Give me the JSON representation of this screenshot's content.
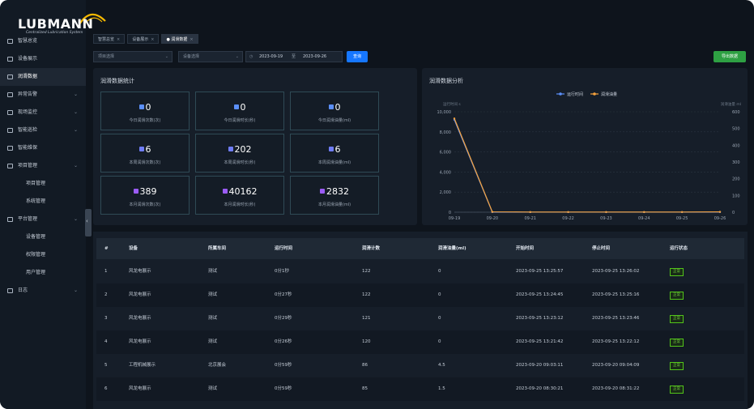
{
  "brand": {
    "name": "LUBMANN",
    "subtitle": "Centralized Lubrication System"
  },
  "sidebar": {
    "items": [
      {
        "label": "智慧总览",
        "icon": "grid-icon",
        "expandable": false
      },
      {
        "label": "设备展示",
        "icon": "gear-icon",
        "expandable": false
      },
      {
        "label": "润滑数据",
        "icon": "drop-icon",
        "expandable": false,
        "active": true
      },
      {
        "label": "异常告警",
        "icon": "alarm-icon",
        "expandable": true
      },
      {
        "label": "现场监控",
        "icon": "monitor-icon",
        "expandable": true
      },
      {
        "label": "智能巡检",
        "icon": "inspect-icon",
        "expandable": true
      },
      {
        "label": "智能维保",
        "icon": "tool-icon",
        "expandable": false
      },
      {
        "label": "项目管理",
        "icon": "folder-icon",
        "expandable": true
      },
      {
        "label": "项目管理",
        "icon": "",
        "expandable": false,
        "sub": true
      },
      {
        "label": "系统管理",
        "icon": "",
        "expandable": false,
        "sub": true
      },
      {
        "label": "平台管理",
        "icon": "settings-icon",
        "expandable": true
      },
      {
        "label": "设备管理",
        "icon": "",
        "expandable": false,
        "sub": true
      },
      {
        "label": "权限管理",
        "icon": "",
        "expandable": false,
        "sub": true
      },
      {
        "label": "用户管理",
        "icon": "",
        "expandable": false,
        "sub": true
      },
      {
        "label": "日志",
        "icon": "log-icon",
        "expandable": true
      }
    ],
    "collapse_glyph": "‹"
  },
  "tabs": [
    {
      "label": "智慧总览",
      "active": false
    },
    {
      "label": "设备展示",
      "active": false
    },
    {
      "label": "● 润滑数据",
      "active": true
    }
  ],
  "filters": {
    "project_placeholder": "项目选择",
    "device_placeholder": "设备选择",
    "date_start": "2023-09-19",
    "date_sep": "至",
    "date_end": "2023-09-26",
    "search_label": "查询",
    "export_label": "导出数据"
  },
  "stats": {
    "title": "润滑数据统计",
    "cards": [
      {
        "value": "0",
        "label": "今日润滑次数(次)",
        "color": "#5b8ff9"
      },
      {
        "value": "0",
        "label": "今日润滑时长(秒)",
        "color": "#5b8ff9"
      },
      {
        "value": "0",
        "label": "今日润滑油量(ml)",
        "color": "#5b8ff9"
      },
      {
        "value": "6",
        "label": "本周润滑次数(次)",
        "color": "#6f7cf6"
      },
      {
        "value": "202",
        "label": "本周润滑时长(秒)",
        "color": "#6f7cf6"
      },
      {
        "value": "6",
        "label": "本周润滑油量(ml)",
        "color": "#6f7cf6"
      },
      {
        "value": "389",
        "label": "本月润滑次数(次)",
        "color": "#9b5cf6"
      },
      {
        "value": "40162",
        "label": "本月润滑时长(秒)",
        "color": "#9b5cf6"
      },
      {
        "value": "2832",
        "label": "本月润滑油量(ml)",
        "color": "#9b5cf6"
      }
    ]
  },
  "chart_title": "润滑数据分析",
  "chart_data": {
    "type": "line",
    "title": "润滑数据分析",
    "categories": [
      "09-19",
      "09-20",
      "09-21",
      "09-22",
      "09-23",
      "09-24",
      "09-25",
      "09-26"
    ],
    "series": [
      {
        "name": "运行时间",
        "axis": "left",
        "color": "#5b8ff9",
        "values": [
          9200,
          10,
          5,
          5,
          5,
          5,
          5,
          15
        ]
      },
      {
        "name": "润滑油量",
        "axis": "right",
        "color": "#f6a23c",
        "values": [
          560,
          2,
          1,
          1,
          1,
          1,
          1,
          2
        ]
      }
    ],
    "ylabel_left": "运行时间 s",
    "ylabel_right": "润滑油量 ml",
    "yticks_left": [
      "0",
      "2,000",
      "4,000",
      "6,000",
      "8,000",
      "10,000"
    ],
    "yticks_right": [
      "0",
      "100",
      "200",
      "300",
      "400",
      "500",
      "600"
    ],
    "ylim_left": [
      0,
      10000
    ],
    "ylim_right": [
      0,
      600
    ],
    "grid": true,
    "legend": "top-center"
  },
  "table": {
    "headers": [
      "#",
      "设备",
      "所属车间",
      "运行时间",
      "润滑计数",
      "润滑油量(ml)",
      "开始时间",
      "停止时间",
      "运行状态"
    ],
    "rows": [
      [
        "1",
        "风龙电展示",
        "测试",
        "0分1秒",
        "122",
        "0",
        "2023-09-25 13:25:57",
        "2023-09-25 13:26:02",
        "正常"
      ],
      [
        "2",
        "风龙电展示",
        "测试",
        "0分27秒",
        "122",
        "0",
        "2023-09-25 13:24:45",
        "2023-09-25 13:25:16",
        "正常"
      ],
      [
        "3",
        "风龙电展示",
        "测试",
        "0分29秒",
        "121",
        "0",
        "2023-09-25 13:23:12",
        "2023-09-25 13:23:46",
        "正常"
      ],
      [
        "4",
        "风龙电展示",
        "测试",
        "0分26秒",
        "120",
        "0",
        "2023-09-25 13:21:42",
        "2023-09-25 13:22:12",
        "正常"
      ],
      [
        "5",
        "工程机械展示",
        "北京展会",
        "0分59秒",
        "86",
        "4.5",
        "2023-09-20 09:03:11",
        "2023-09-20 09:04:09",
        "正常"
      ],
      [
        "6",
        "风龙电展示",
        "测试",
        "0分59秒",
        "85",
        "1.5",
        "2023-09-20 08:30:21",
        "2023-09-20 08:31:22",
        "正常"
      ]
    ]
  },
  "colors": {
    "status_ok": "#52c41a",
    "primary": "#1677ff",
    "export": "#2ea043"
  }
}
